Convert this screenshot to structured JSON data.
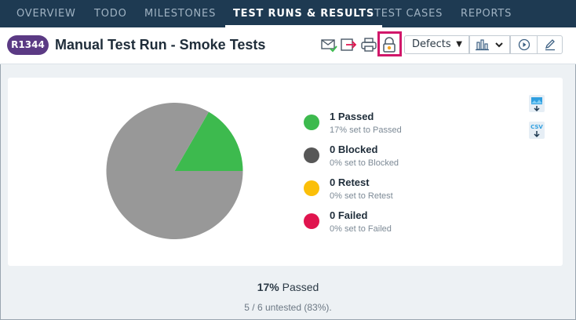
{
  "nav": {
    "tabs": [
      {
        "label": "OVERVIEW",
        "active": false
      },
      {
        "label": "TODO",
        "active": false
      },
      {
        "label": "MILESTONES",
        "active": false
      },
      {
        "label": "TEST RUNS & RESULTS",
        "active": true
      },
      {
        "label": "TEST CASES",
        "active": false
      },
      {
        "label": "REPORTS",
        "active": false
      }
    ]
  },
  "header": {
    "run_id": "R1344",
    "title": "Manual Test Run - Smoke Tests",
    "defects_label": "Defects",
    "icons": [
      "email-icon",
      "export-icon",
      "print-icon",
      "lock-icon",
      "chart-icon",
      "play-icon",
      "edit-icon"
    ]
  },
  "colors": {
    "passed": "#3dba4e",
    "blocked": "#575757",
    "retest": "#fbbf09",
    "failed": "#e0144e",
    "untested": "#989898",
    "highlight": "#d1176a"
  },
  "chart_data": {
    "type": "pie",
    "slices": [
      {
        "name": "Passed",
        "value": 1
      },
      {
        "name": "Untested",
        "value": 5
      }
    ]
  },
  "legend": [
    {
      "title": "1 Passed",
      "sub": "17% set to Passed"
    },
    {
      "title": "0 Blocked",
      "sub": "0% set to Blocked"
    },
    {
      "title": "0 Retest",
      "sub": "0% set to Retest"
    },
    {
      "title": "0 Failed",
      "sub": "0% set to Failed"
    }
  ],
  "summary": {
    "percent": "17%",
    "label": "Passed",
    "untested": "5 / 6 untested (83%)."
  }
}
